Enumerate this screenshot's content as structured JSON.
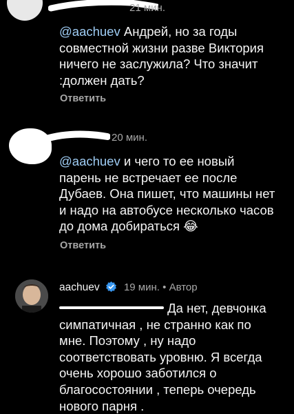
{
  "comments": [
    {
      "time": "21 мин.",
      "mention": "@aachuev",
      "text": "Андрей, но за годы совместной жизни разве Виктория ничего не заслужила? Что значит :должен дать?",
      "reply_label": "Ответить"
    },
    {
      "time": "20 мин.",
      "mention": "@aachuev",
      "text": "и чего то ее новый парень не встречает ее после Дубаев. Она пишет, что машины нет и надо на автобусе несколько часов до дома добираться 😂",
      "reply_label": "Ответить"
    },
    {
      "username": "aachuev",
      "time": "19 мин.",
      "separator": "•",
      "author_badge": "Автор",
      "text": "Да нет, девчонка симпатичная , не странно как по мне. Поэтому , ну надо соответствовать уровню. Я всегда очень хорошо заботился о благосостоянии , теперь очередь нового парня ."
    }
  ],
  "colors": {
    "background": "#000000",
    "text": "#f5f5f5",
    "muted": "#a8a8a8",
    "verified": "#3897f0"
  },
  "icons": {
    "verified": "verified-badge-icon"
  }
}
